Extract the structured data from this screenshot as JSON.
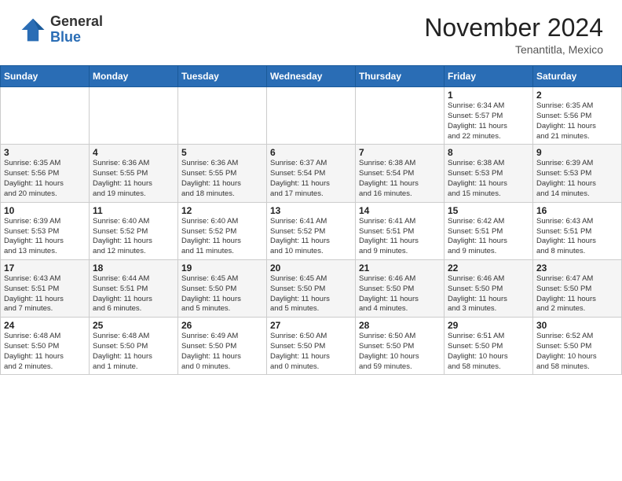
{
  "header": {
    "logo_general": "General",
    "logo_blue": "Blue",
    "month_title": "November 2024",
    "location": "Tenantitla, Mexico"
  },
  "days_of_week": [
    "Sunday",
    "Monday",
    "Tuesday",
    "Wednesday",
    "Thursday",
    "Friday",
    "Saturday"
  ],
  "weeks": [
    [
      {
        "day": "",
        "info": ""
      },
      {
        "day": "",
        "info": ""
      },
      {
        "day": "",
        "info": ""
      },
      {
        "day": "",
        "info": ""
      },
      {
        "day": "",
        "info": ""
      },
      {
        "day": "1",
        "info": "Sunrise: 6:34 AM\nSunset: 5:57 PM\nDaylight: 11 hours\nand 22 minutes."
      },
      {
        "day": "2",
        "info": "Sunrise: 6:35 AM\nSunset: 5:56 PM\nDaylight: 11 hours\nand 21 minutes."
      }
    ],
    [
      {
        "day": "3",
        "info": "Sunrise: 6:35 AM\nSunset: 5:56 PM\nDaylight: 11 hours\nand 20 minutes."
      },
      {
        "day": "4",
        "info": "Sunrise: 6:36 AM\nSunset: 5:55 PM\nDaylight: 11 hours\nand 19 minutes."
      },
      {
        "day": "5",
        "info": "Sunrise: 6:36 AM\nSunset: 5:55 PM\nDaylight: 11 hours\nand 18 minutes."
      },
      {
        "day": "6",
        "info": "Sunrise: 6:37 AM\nSunset: 5:54 PM\nDaylight: 11 hours\nand 17 minutes."
      },
      {
        "day": "7",
        "info": "Sunrise: 6:38 AM\nSunset: 5:54 PM\nDaylight: 11 hours\nand 16 minutes."
      },
      {
        "day": "8",
        "info": "Sunrise: 6:38 AM\nSunset: 5:53 PM\nDaylight: 11 hours\nand 15 minutes."
      },
      {
        "day": "9",
        "info": "Sunrise: 6:39 AM\nSunset: 5:53 PM\nDaylight: 11 hours\nand 14 minutes."
      }
    ],
    [
      {
        "day": "10",
        "info": "Sunrise: 6:39 AM\nSunset: 5:53 PM\nDaylight: 11 hours\nand 13 minutes."
      },
      {
        "day": "11",
        "info": "Sunrise: 6:40 AM\nSunset: 5:52 PM\nDaylight: 11 hours\nand 12 minutes."
      },
      {
        "day": "12",
        "info": "Sunrise: 6:40 AM\nSunset: 5:52 PM\nDaylight: 11 hours\nand 11 minutes."
      },
      {
        "day": "13",
        "info": "Sunrise: 6:41 AM\nSunset: 5:52 PM\nDaylight: 11 hours\nand 10 minutes."
      },
      {
        "day": "14",
        "info": "Sunrise: 6:41 AM\nSunset: 5:51 PM\nDaylight: 11 hours\nand 9 minutes."
      },
      {
        "day": "15",
        "info": "Sunrise: 6:42 AM\nSunset: 5:51 PM\nDaylight: 11 hours\nand 9 minutes."
      },
      {
        "day": "16",
        "info": "Sunrise: 6:43 AM\nSunset: 5:51 PM\nDaylight: 11 hours\nand 8 minutes."
      }
    ],
    [
      {
        "day": "17",
        "info": "Sunrise: 6:43 AM\nSunset: 5:51 PM\nDaylight: 11 hours\nand 7 minutes."
      },
      {
        "day": "18",
        "info": "Sunrise: 6:44 AM\nSunset: 5:51 PM\nDaylight: 11 hours\nand 6 minutes."
      },
      {
        "day": "19",
        "info": "Sunrise: 6:45 AM\nSunset: 5:50 PM\nDaylight: 11 hours\nand 5 minutes."
      },
      {
        "day": "20",
        "info": "Sunrise: 6:45 AM\nSunset: 5:50 PM\nDaylight: 11 hours\nand 5 minutes."
      },
      {
        "day": "21",
        "info": "Sunrise: 6:46 AM\nSunset: 5:50 PM\nDaylight: 11 hours\nand 4 minutes."
      },
      {
        "day": "22",
        "info": "Sunrise: 6:46 AM\nSunset: 5:50 PM\nDaylight: 11 hours\nand 3 minutes."
      },
      {
        "day": "23",
        "info": "Sunrise: 6:47 AM\nSunset: 5:50 PM\nDaylight: 11 hours\nand 2 minutes."
      }
    ],
    [
      {
        "day": "24",
        "info": "Sunrise: 6:48 AM\nSunset: 5:50 PM\nDaylight: 11 hours\nand 2 minutes."
      },
      {
        "day": "25",
        "info": "Sunrise: 6:48 AM\nSunset: 5:50 PM\nDaylight: 11 hours\nand 1 minute."
      },
      {
        "day": "26",
        "info": "Sunrise: 6:49 AM\nSunset: 5:50 PM\nDaylight: 11 hours\nand 0 minutes."
      },
      {
        "day": "27",
        "info": "Sunrise: 6:50 AM\nSunset: 5:50 PM\nDaylight: 11 hours\nand 0 minutes."
      },
      {
        "day": "28",
        "info": "Sunrise: 6:50 AM\nSunset: 5:50 PM\nDaylight: 10 hours\nand 59 minutes."
      },
      {
        "day": "29",
        "info": "Sunrise: 6:51 AM\nSunset: 5:50 PM\nDaylight: 10 hours\nand 58 minutes."
      },
      {
        "day": "30",
        "info": "Sunrise: 6:52 AM\nSunset: 5:50 PM\nDaylight: 10 hours\nand 58 minutes."
      }
    ]
  ]
}
